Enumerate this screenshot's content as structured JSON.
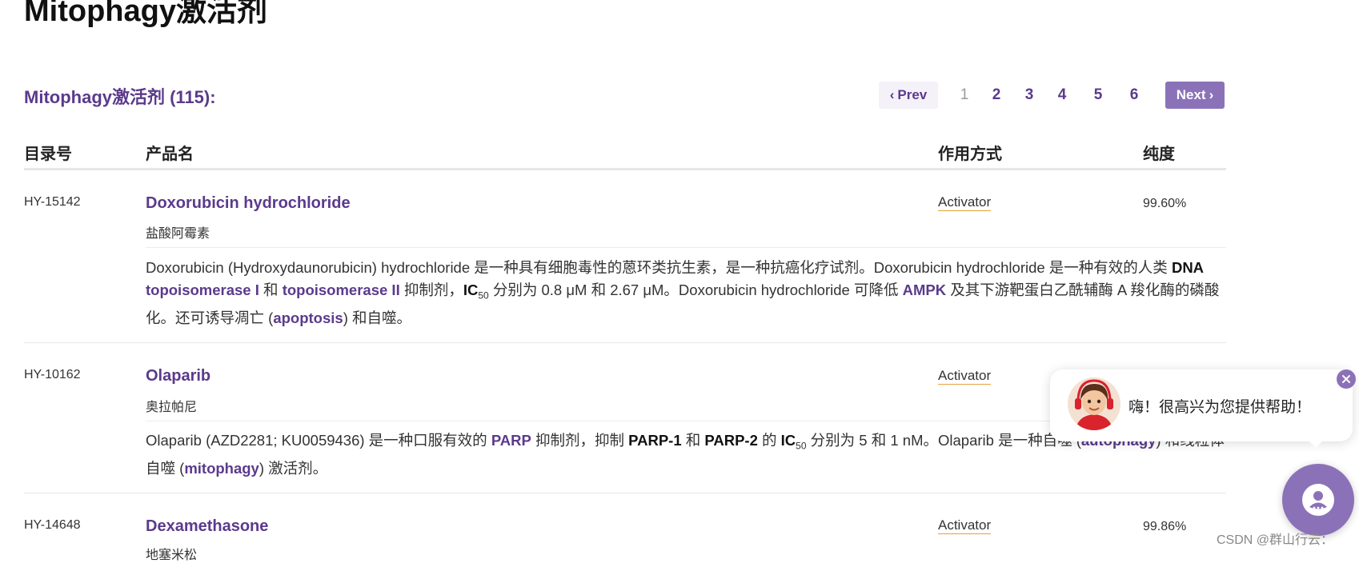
{
  "page_title": "Mitophagy激活剂",
  "section_title": "Mitophagy激活剂 (115):",
  "pagination": {
    "prev_label": "Prev",
    "next_label": "Next",
    "pages": [
      "1",
      "2",
      "3",
      "4",
      "5",
      "6"
    ],
    "current_page": "1"
  },
  "table": {
    "headers": {
      "catalog": "目录号",
      "name": "产品名",
      "moa": "作用方式",
      "purity": "纯度"
    },
    "rows": [
      {
        "catalog": "HY-15142",
        "name": "Doxorubicin hydrochloride",
        "cn_name": "盐酸阿霉素",
        "moa": "Activator",
        "purity": "99.60%",
        "desc": {
          "t1": "Doxorubicin (Hydroxydaunorubicin) hydrochloride 是一种具有细胞毒性的蒽环类抗生素，是一种抗癌化疗试剂。Doxorubicin hydrochloride 是一种有效的人类 ",
          "b1": "DNA",
          "l1": "topoisomerase I",
          "t2": "和",
          "l2": "topoisomerase II",
          "t3": "抑制剂，",
          "b2": "IC",
          "sub": "50",
          "t4": " 分别为 0.8 μM 和 2.67 μM。Doxorubicin hydrochloride 可降低 ",
          "l3": "AMPK",
          "t5": " 及其下游靶蛋白乙酰辅酶 A 羧化酶的磷酸化。还可诱导凋亡 (",
          "l4": "apoptosis",
          "t6": ") 和自噬。"
        }
      },
      {
        "catalog": "HY-10162",
        "name": "Olaparib",
        "cn_name": "奥拉帕尼",
        "moa": "Activator",
        "purity": "",
        "desc": {
          "t1": "Olaparib (AZD2281; KU0059436) 是一种口服有效的 ",
          "l1": "PARP",
          "t2": " 抑制剂，抑制 ",
          "b1": "PARP-1",
          "t3": " 和 ",
          "b2": "PARP-2",
          "t4": " 的 ",
          "b3": "IC",
          "sub": "50",
          "t5": " 分别为 5 和 1 nM。Olaparib 是一种自噬 (",
          "l2": "autophagy",
          "t6": ") 和线粒体自噬 (",
          "l3": "mitophagy",
          "t7": ") 激活剂。"
        }
      },
      {
        "catalog": "HY-14648",
        "name": "Dexamethasone",
        "cn_name": "地塞米松",
        "moa": "Activator",
        "purity": "99.86%"
      }
    ]
  },
  "chat": {
    "greeting": "嗨！很高兴为您提供帮助！",
    "accent_color": "#8b72b8"
  },
  "watermark": "CSDN @群山行云：",
  "colors": {
    "brand_purple": "#5b3a8c",
    "button_purple": "#8b72b8",
    "underline_orange": "#e6a23c"
  }
}
